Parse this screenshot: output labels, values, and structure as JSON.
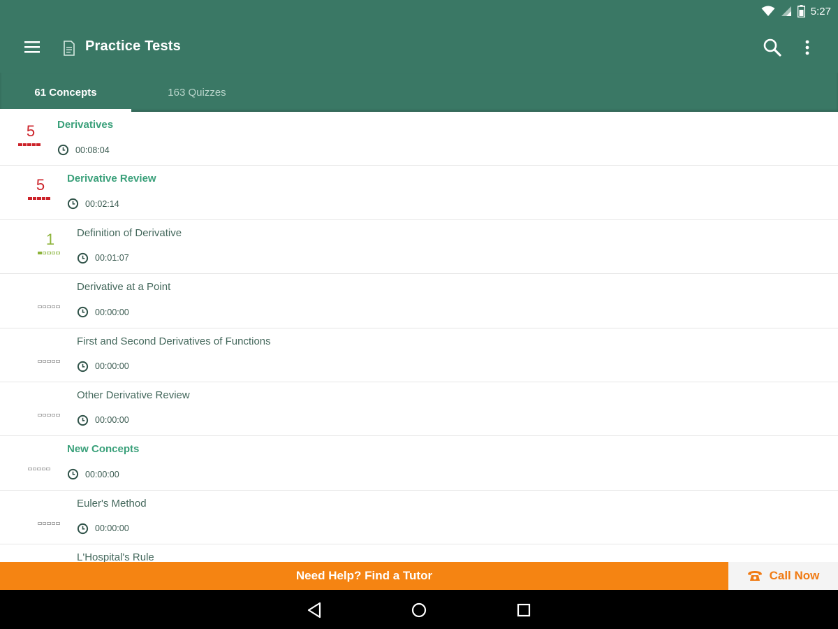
{
  "status_bar": {
    "time": "5:27",
    "icons": [
      "wifi-icon",
      "signal-icon",
      "battery-icon"
    ]
  },
  "toolbar": {
    "title": "Practice Tests",
    "icons": [
      "menu-icon",
      "document-icon",
      "search-icon",
      "more-vert-icon"
    ]
  },
  "tabs": [
    {
      "label": "61 Concepts",
      "active": true
    },
    {
      "label": "163 Quizzes",
      "active": false
    }
  ],
  "concepts": [
    {
      "name": "Derivatives",
      "time": "00:08:04",
      "score": "5",
      "level": 0,
      "header": true,
      "score_color": "red",
      "mastery": 5
    },
    {
      "name": "Derivative Review",
      "time": "00:02:14",
      "score": "5",
      "level": 1,
      "header": true,
      "score_color": "red",
      "mastery": 5
    },
    {
      "name": "Definition of Derivative",
      "time": "00:01:07",
      "score": "1",
      "level": 2,
      "header": false,
      "score_color": "green",
      "mastery": 1
    },
    {
      "name": "Derivative at a Point",
      "time": "00:00:00",
      "score": "",
      "level": 2,
      "header": false,
      "score_color": "grey",
      "mastery": 0
    },
    {
      "name": "First and Second Derivatives of Functions",
      "time": "00:00:00",
      "score": "",
      "level": 2,
      "header": false,
      "score_color": "grey",
      "mastery": 0
    },
    {
      "name": "Other Derivative Review",
      "time": "00:00:00",
      "score": "",
      "level": 2,
      "header": false,
      "score_color": "grey",
      "mastery": 0
    },
    {
      "name": "New Concepts",
      "time": "00:00:00",
      "score": "",
      "level": 1,
      "header": true,
      "score_color": "grey",
      "mastery": 0
    },
    {
      "name": "Euler's Method",
      "time": "00:00:00",
      "score": "",
      "level": 2,
      "header": false,
      "score_color": "grey",
      "mastery": 0
    },
    {
      "name": "L'Hospital's Rule",
      "time": "",
      "score": "",
      "level": 2,
      "header": false,
      "score_color": "grey",
      "mastery": 0
    }
  ],
  "help_bar": {
    "tutor_label": "Need Help? Find a Tutor",
    "call_label": "Call Now",
    "call_icon": "phone-icon"
  },
  "nav_bar": {
    "icons": [
      "back-icon",
      "home-icon",
      "recents-icon"
    ]
  },
  "colors": {
    "primary": "#3a7865",
    "header_text": "#3aa07a",
    "score_red": "#cc2229",
    "score_green": "#8db33a",
    "accent_orange": "#f58412"
  }
}
